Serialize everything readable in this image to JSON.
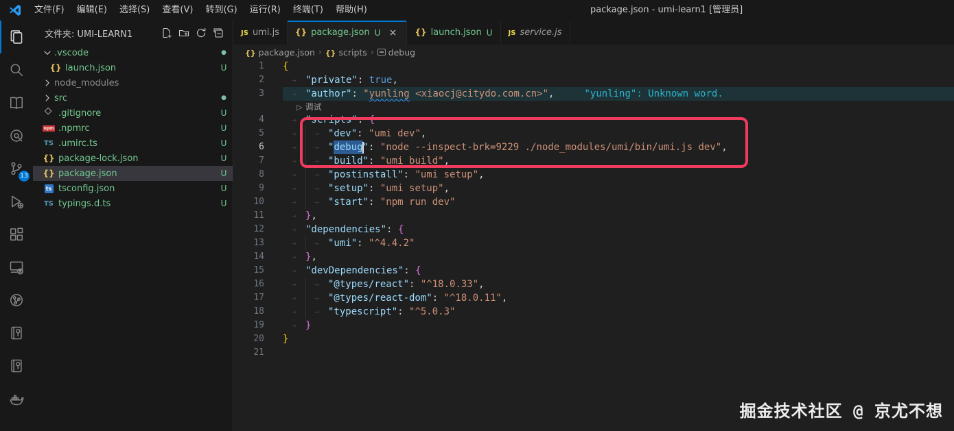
{
  "title_bar": {
    "title": "package.json - umi-learn1 [管理员]",
    "menus": [
      "文件(F)",
      "编辑(E)",
      "选择(S)",
      "查看(V)",
      "转到(G)",
      "运行(R)",
      "终端(T)",
      "帮助(H)"
    ]
  },
  "activity_bar": {
    "items": [
      {
        "name": "explorer",
        "active": true
      },
      {
        "name": "search"
      },
      {
        "name": "book-reader"
      },
      {
        "name": "gitlens"
      },
      {
        "name": "source-control",
        "badge": "13"
      },
      {
        "name": "run-debug"
      },
      {
        "name": "extensions"
      },
      {
        "name": "remote-explorer"
      },
      {
        "name": "git-graph"
      },
      {
        "name": "notebook-tree-1"
      },
      {
        "name": "notebook-tree-2"
      },
      {
        "name": "docker"
      }
    ]
  },
  "sidebar": {
    "header": {
      "label": "文件夹: UMI-LEARN1",
      "actions": [
        {
          "name": "new-file"
        },
        {
          "name": "new-folder"
        },
        {
          "name": "refresh"
        },
        {
          "name": "collapse-all"
        }
      ]
    },
    "tree": [
      {
        "name": ".vscode",
        "type": "folder",
        "expanded": true,
        "badge": "dot"
      },
      {
        "name": "launch.json",
        "type": "json",
        "badge": "U",
        "child": true
      },
      {
        "name": "node_modules",
        "type": "folder",
        "expanded": false,
        "dim": true
      },
      {
        "name": "src",
        "type": "folder",
        "expanded": false,
        "badge": "dot"
      },
      {
        "name": ".gitignore",
        "type": "git",
        "badge": "U"
      },
      {
        "name": ".npmrc",
        "type": "npm",
        "badge": "U"
      },
      {
        "name": ".umirc.ts",
        "type": "ts",
        "badge": "U"
      },
      {
        "name": "package-lock.json",
        "type": "json",
        "badge": "U"
      },
      {
        "name": "package.json",
        "type": "json",
        "badge": "U",
        "selected": true
      },
      {
        "name": "tsconfig.json",
        "type": "tsconfig",
        "badge": "U"
      },
      {
        "name": "typings.d.ts",
        "type": "ts",
        "badge": "U"
      }
    ]
  },
  "editor": {
    "tabs": [
      {
        "label": "umi.js",
        "icon": "js"
      },
      {
        "label": "package.json",
        "icon": "json",
        "suffix": "U",
        "active": true,
        "close": "×",
        "green": true
      },
      {
        "label": "launch.json",
        "icon": "json",
        "suffix": "U",
        "green": true
      },
      {
        "label": "service.js",
        "icon": "js",
        "preview": true
      }
    ],
    "breadcrumb": [
      {
        "icon": "json",
        "label": "package.json"
      },
      {
        "icon": "json",
        "label": "scripts"
      },
      {
        "icon": "property",
        "label": "debug"
      }
    ],
    "code_lens": "调试",
    "inline_hint": "\"yunling\": Unknown word.",
    "watermark": "掘金技术社区 @ 京尤不想",
    "lines": [
      {
        "n": 1,
        "i": 0,
        "t": [
          {
            "c": "b1",
            "s": "{"
          }
        ]
      },
      {
        "n": 2,
        "i": 1,
        "t": [
          {
            "c": "key",
            "s": "\"private\""
          },
          {
            "c": "punc",
            "s": ": "
          },
          {
            "c": "kw",
            "s": "true"
          },
          {
            "c": "punc",
            "s": ","
          }
        ]
      },
      {
        "n": 3,
        "i": 1,
        "hl": true,
        "hint": true,
        "t": [
          {
            "c": "key",
            "s": "\"author\""
          },
          {
            "c": "punc",
            "s": ": "
          },
          {
            "c": "str",
            "s": "\""
          },
          {
            "c": "str",
            "s": "yunling",
            "sq": true
          },
          {
            "c": "str",
            "s": " <xiaocj@citydo.com.cn>\""
          },
          {
            "c": "punc",
            "s": ","
          }
        ]
      },
      {
        "n": 4,
        "i": 1,
        "lens": true,
        "t": [
          {
            "c": "key",
            "s": "\"scripts\""
          },
          {
            "c": "punc",
            "s": ": "
          },
          {
            "c": "b2",
            "s": "{"
          }
        ]
      },
      {
        "n": 5,
        "i": 2,
        "t": [
          {
            "c": "key",
            "s": "\"dev\""
          },
          {
            "c": "punc",
            "s": ": "
          },
          {
            "c": "str",
            "s": "\"umi dev\""
          },
          {
            "c": "punc",
            "s": ","
          }
        ]
      },
      {
        "n": 6,
        "i": 2,
        "cur": true,
        "t": [
          {
            "c": "key",
            "s": "\""
          },
          {
            "c": "key",
            "s": "debug",
            "sel": true
          },
          {
            "c": "cursor",
            "s": ""
          },
          {
            "c": "key",
            "s": "\""
          },
          {
            "c": "punc",
            "s": ": "
          },
          {
            "c": "str",
            "s": "\"node --inspect-brk=9229 ./node_modules/umi/bin/umi.js dev\""
          },
          {
            "c": "punc",
            "s": ","
          }
        ]
      },
      {
        "n": 7,
        "i": 2,
        "t": [
          {
            "c": "key",
            "s": "\"build\""
          },
          {
            "c": "punc",
            "s": ": "
          },
          {
            "c": "str",
            "s": "\"umi build\""
          },
          {
            "c": "punc",
            "s": ","
          }
        ]
      },
      {
        "n": 8,
        "i": 2,
        "t": [
          {
            "c": "key",
            "s": "\"postinstall\""
          },
          {
            "c": "punc",
            "s": ": "
          },
          {
            "c": "str",
            "s": "\"umi setup\""
          },
          {
            "c": "punc",
            "s": ","
          }
        ]
      },
      {
        "n": 9,
        "i": 2,
        "t": [
          {
            "c": "key",
            "s": "\"setup\""
          },
          {
            "c": "punc",
            "s": ": "
          },
          {
            "c": "str",
            "s": "\"umi setup\""
          },
          {
            "c": "punc",
            "s": ","
          }
        ]
      },
      {
        "n": 10,
        "i": 2,
        "t": [
          {
            "c": "key",
            "s": "\"start\""
          },
          {
            "c": "punc",
            "s": ": "
          },
          {
            "c": "str",
            "s": "\"npm run dev\""
          }
        ]
      },
      {
        "n": 11,
        "i": 1,
        "t": [
          {
            "c": "b2",
            "s": "}"
          },
          {
            "c": "punc",
            "s": ","
          }
        ]
      },
      {
        "n": 12,
        "i": 1,
        "t": [
          {
            "c": "key",
            "s": "\"dependencies\""
          },
          {
            "c": "punc",
            "s": ": "
          },
          {
            "c": "b2",
            "s": "{"
          }
        ]
      },
      {
        "n": 13,
        "i": 2,
        "t": [
          {
            "c": "key",
            "s": "\"umi\""
          },
          {
            "c": "punc",
            "s": ": "
          },
          {
            "c": "str",
            "s": "\"^4.4.2\""
          }
        ]
      },
      {
        "n": 14,
        "i": 1,
        "t": [
          {
            "c": "b2",
            "s": "}"
          },
          {
            "c": "punc",
            "s": ","
          }
        ]
      },
      {
        "n": 15,
        "i": 1,
        "t": [
          {
            "c": "key",
            "s": "\"devDependencies\""
          },
          {
            "c": "punc",
            "s": ": "
          },
          {
            "c": "b2",
            "s": "{"
          }
        ]
      },
      {
        "n": 16,
        "i": 2,
        "t": [
          {
            "c": "key",
            "s": "\"@types/react\""
          },
          {
            "c": "punc",
            "s": ": "
          },
          {
            "c": "str",
            "s": "\"^18.0.33\""
          },
          {
            "c": "punc",
            "s": ","
          }
        ]
      },
      {
        "n": 17,
        "i": 2,
        "t": [
          {
            "c": "key",
            "s": "\"@types/react-dom\""
          },
          {
            "c": "punc",
            "s": ": "
          },
          {
            "c": "str",
            "s": "\"^18.0.11\""
          },
          {
            "c": "punc",
            "s": ","
          }
        ]
      },
      {
        "n": 18,
        "i": 2,
        "t": [
          {
            "c": "key",
            "s": "\"typescript\""
          },
          {
            "c": "punc",
            "s": ": "
          },
          {
            "c": "str",
            "s": "\"^5.0.3\""
          }
        ]
      },
      {
        "n": 19,
        "i": 1,
        "t": [
          {
            "c": "b2",
            "s": "}"
          }
        ]
      },
      {
        "n": 20,
        "i": 0,
        "t": [
          {
            "c": "b1",
            "s": "}"
          }
        ]
      },
      {
        "n": 21,
        "i": 0,
        "t": []
      }
    ]
  },
  "colors": {
    "accent": "#0078d4",
    "untracked_green": "#73c991",
    "annotation_red": "#ef3b5d",
    "selection_blue": "#2d5c94",
    "hint_cyan": "#2cb1c9"
  }
}
